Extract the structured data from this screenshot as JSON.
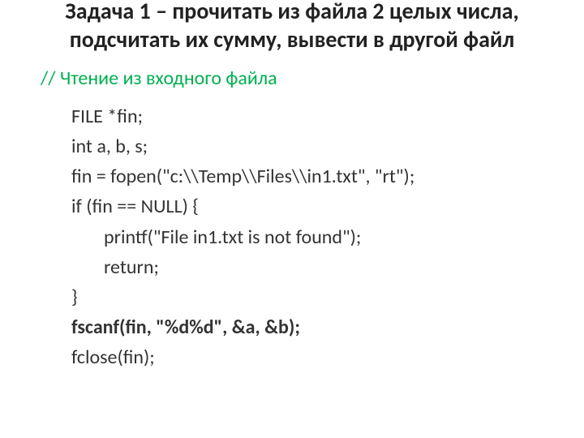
{
  "title": "Задача 1 – прочитать из файла 2 целых числа, подсчитать их сумму, вывести в другой файл",
  "comment": "// Чтение из входного файла",
  "lines": {
    "l0": "FILE *fin;",
    "l1": "int a, b, s;",
    "l2": "fin = fopen(\"c:\\\\Temp\\\\Files\\\\in1.txt\", \"rt\");",
    "l3": "if (fin == NULL) {",
    "l4": "printf(\"File in1.txt is not found\");",
    "l5": "return;",
    "l6": "}",
    "l7": "fscanf(fin, \"%d%d\", &a, &b);",
    "l8": "fclose(fin);"
  }
}
